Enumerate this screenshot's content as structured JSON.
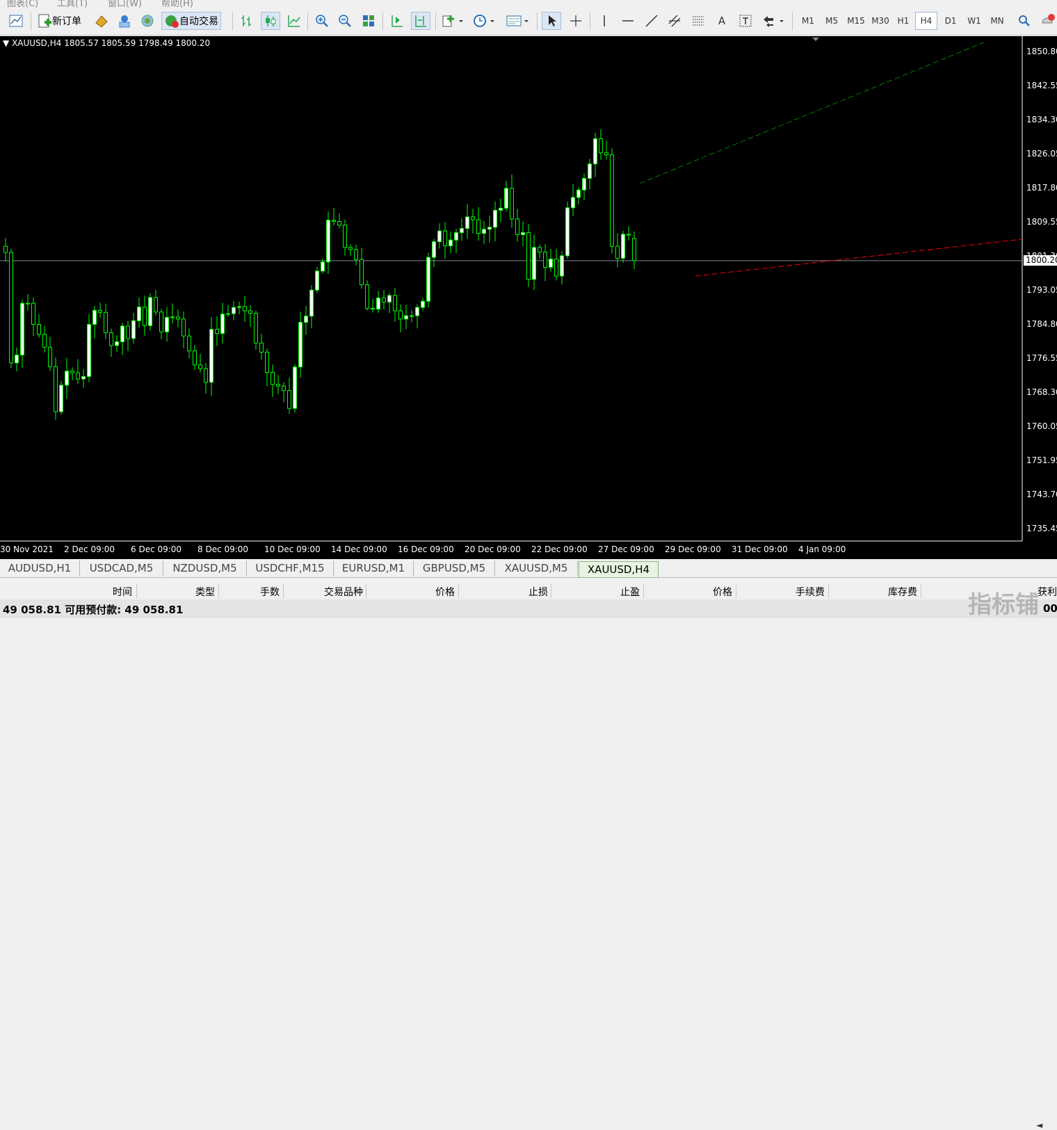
{
  "menu": [
    "图表(C)",
    "工具(T)",
    "窗口(W)",
    "帮助(H)"
  ],
  "toolbar": {
    "new_order": "新订单",
    "auto_trade": "自动交易"
  },
  "timeframes": [
    "M1",
    "M5",
    "M15",
    "M30",
    "H1",
    "H4",
    "D1",
    "W1",
    "MN"
  ],
  "active_timeframe": "H4",
  "chart": {
    "symbol_line": "XAUUSD,H4  1805.57 1805.59 1798.49 1800.20",
    "price_labels": [
      "1850.80",
      "1842.55",
      "1834.30",
      "1826.05",
      "1817.80",
      "1809.55",
      "1801.30",
      "1793.05",
      "1784.80",
      "1776.55",
      "1768.30",
      "1760.05",
      "1751.95",
      "1743.70",
      "1735.45"
    ],
    "current_price": "1800.20",
    "time_labels": [
      "30 Nov 2021",
      "2 Dec 09:00",
      "6 Dec 09:00",
      "8 Dec 09:00",
      "10 Dec 09:00",
      "14 Dec 09:00",
      "16 Dec 09:00",
      "20 Dec 09:00",
      "22 Dec 09:00",
      "27 Dec 09:00",
      "29 Dec 09:00",
      "31 Dec 09:00",
      "4 Jan 09:00"
    ]
  },
  "chart_data": {
    "type": "candlestick",
    "symbol": "XAUUSD",
    "timeframe": "H4",
    "last_bar": {
      "open": 1805.57,
      "high": 1805.59,
      "low": 1798.49,
      "close": 1800.2
    },
    "ylim": [
      1735.45,
      1850.8
    ],
    "grid": false,
    "closes": [
      1802.2,
      1775.5,
      1777.4,
      1789.9,
      1789.9,
      1784.8,
      1782.4,
      1779.3,
      1774.6,
      1763.7,
      1770.1,
      1773.5,
      1773.1,
      1771.6,
      1772.2,
      1784.8,
      1788.2,
      1787.7,
      1782.8,
      1779.7,
      1780.6,
      1784.4,
      1781.4,
      1785.7,
      1789.0,
      1784.5,
      1791.3,
      1787.8,
      1783.0,
      1786.5,
      1786.6,
      1786.1,
      1782.0,
      1778.4,
      1775.0,
      1774.1,
      1770.8,
      1783.6,
      1782.6,
      1787.3,
      1787.4,
      1788.9,
      1789.1,
      1788.1,
      1787.5,
      1780.3,
      1778.1,
      1773.2,
      1770.3,
      1769.9,
      1768.8,
      1764.5,
      1774.5,
      1785.3,
      1786.8,
      1793.1,
      1797.7,
      1799.9,
      1810.0,
      1809.7,
      1808.8,
      1803.4,
      1802.9,
      1800.5,
      1794.4,
      1788.7,
      1788.5,
      1791.2,
      1790.2,
      1791.8,
      1788.1,
      1786.1,
      1786.9,
      1786.9,
      1788.9,
      1790.4,
      1801.0,
      1804.8,
      1807.4,
      1803.8,
      1805.2,
      1807.0,
      1808.0,
      1810.8,
      1810.1,
      1806.8,
      1807.8,
      1808.3,
      1812.4,
      1812.9,
      1817.7,
      1810.3,
      1806.5,
      1807.0,
      1795.7,
      1803.4,
      1802.3,
      1798.6,
      1800.6,
      1796.5,
      1801.4,
      1813.0,
      1815.5,
      1817.3,
      1820.1,
      1823.6,
      1829.7,
      1826.3,
      1825.8,
      1803.7,
      1800.8,
      1806.6,
      1806.4,
      1800.2
    ]
  },
  "tabs": [
    "AUDUSD,H1",
    "USDCAD,M5",
    "NZDUSD,M5",
    "USDCHF,M15",
    "EURUSD,M1",
    "GBPUSD,M5",
    "XAUUSD,M5",
    "XAUUSD,H4"
  ],
  "active_tab": "XAUUSD,H4",
  "columns": [
    "时间",
    "类型",
    "手数",
    "交易品种",
    "价格",
    "止损",
    "止盈",
    "价格",
    "手续费",
    "库存费",
    "获利"
  ],
  "status": {
    "text": "49 058.81  可用预付款: 49 058.81",
    "right": "00"
  },
  "watermark": "指标铺",
  "colors": {
    "candle_up": "#ffffff",
    "candle_down": "#000000",
    "wick": "#00ff00",
    "upper_trendline": "#008000",
    "lower_trendline": "#ff0000",
    "current_price_line": "#7f8896"
  }
}
